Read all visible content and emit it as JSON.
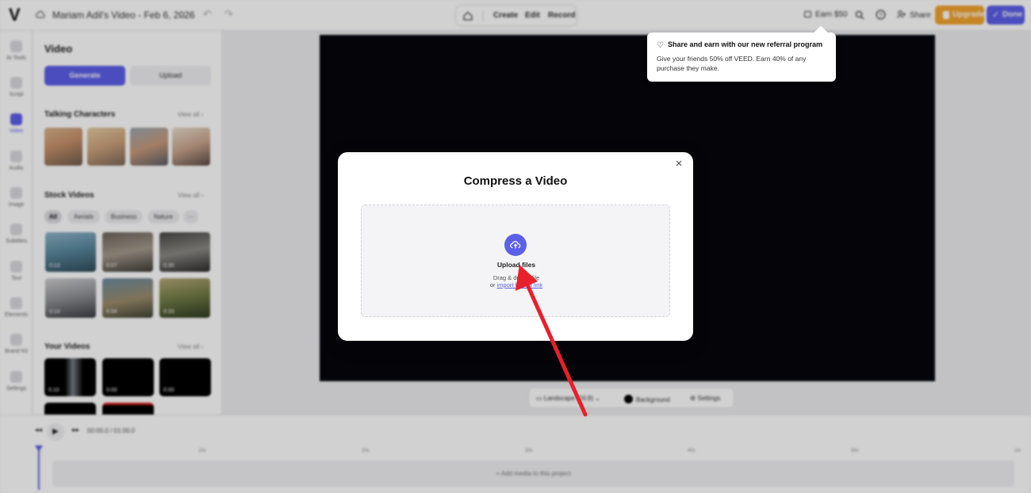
{
  "topbar": {
    "project_title": "Mariam Adil's Video - Feb 6, 2026",
    "nav": [
      "Create",
      "Edit",
      "Record"
    ],
    "earn": "Earn $50",
    "share": "Share",
    "upgrade": "Upgrade",
    "done": "Done"
  },
  "iconbar": [
    {
      "label": "AI Tools",
      "icon": "sparkle-icon"
    },
    {
      "label": "Script",
      "icon": "script-icon"
    },
    {
      "label": "Video",
      "icon": "video-icon"
    },
    {
      "label": "Audio",
      "icon": "audio-icon"
    },
    {
      "label": "Image",
      "icon": "image-icon"
    },
    {
      "label": "Subtitles",
      "icon": "subtitles-icon"
    },
    {
      "label": "Text",
      "icon": "text-icon"
    },
    {
      "label": "Elements",
      "icon": "elements-icon"
    },
    {
      "label": "Brand Kit",
      "icon": "brand-kit-icon"
    },
    {
      "label": "Settings",
      "icon": "settings-icon"
    }
  ],
  "panel": {
    "title": "Video",
    "generate": "Generate",
    "upload": "Upload",
    "talking_characters": "Talking Characters",
    "view_all": "View all",
    "stock_videos": "Stock Videos",
    "chips": [
      "All",
      "Aerials",
      "Business",
      "Nature",
      "···"
    ],
    "stock_durations": [
      "0:13",
      "0:07",
      "0:30",
      "0:14",
      "0:34",
      "0:33"
    ],
    "your_videos": "Your Videos",
    "your_durations": [
      "0:10",
      "0:00",
      "0:00"
    ]
  },
  "canvas_bar": {
    "aspect": "Landscape (16:9)",
    "background": "Background",
    "settings": "Settings"
  },
  "timeline": {
    "current": "00:00.0",
    "separator": "/",
    "total": "01:00.0",
    "ticks": [
      "10s",
      "20s",
      "30s",
      "40s",
      "50s",
      "1m"
    ],
    "add_media": "+ Add media to this project"
  },
  "tooltip": {
    "title": "Share and earn with our new referral program",
    "body": "Give your friends 50% off VEED. Earn 40% of any purchase they make."
  },
  "modal": {
    "title": "Compress a Video",
    "upload_label": "Upload files",
    "drag_text": "Drag & drop a file",
    "or": "or",
    "import_link": "import from a link"
  },
  "colors": {
    "accent": "#5c5fe8",
    "upgrade": "#f2a32d",
    "annotation_arrow": "#e8202a"
  }
}
